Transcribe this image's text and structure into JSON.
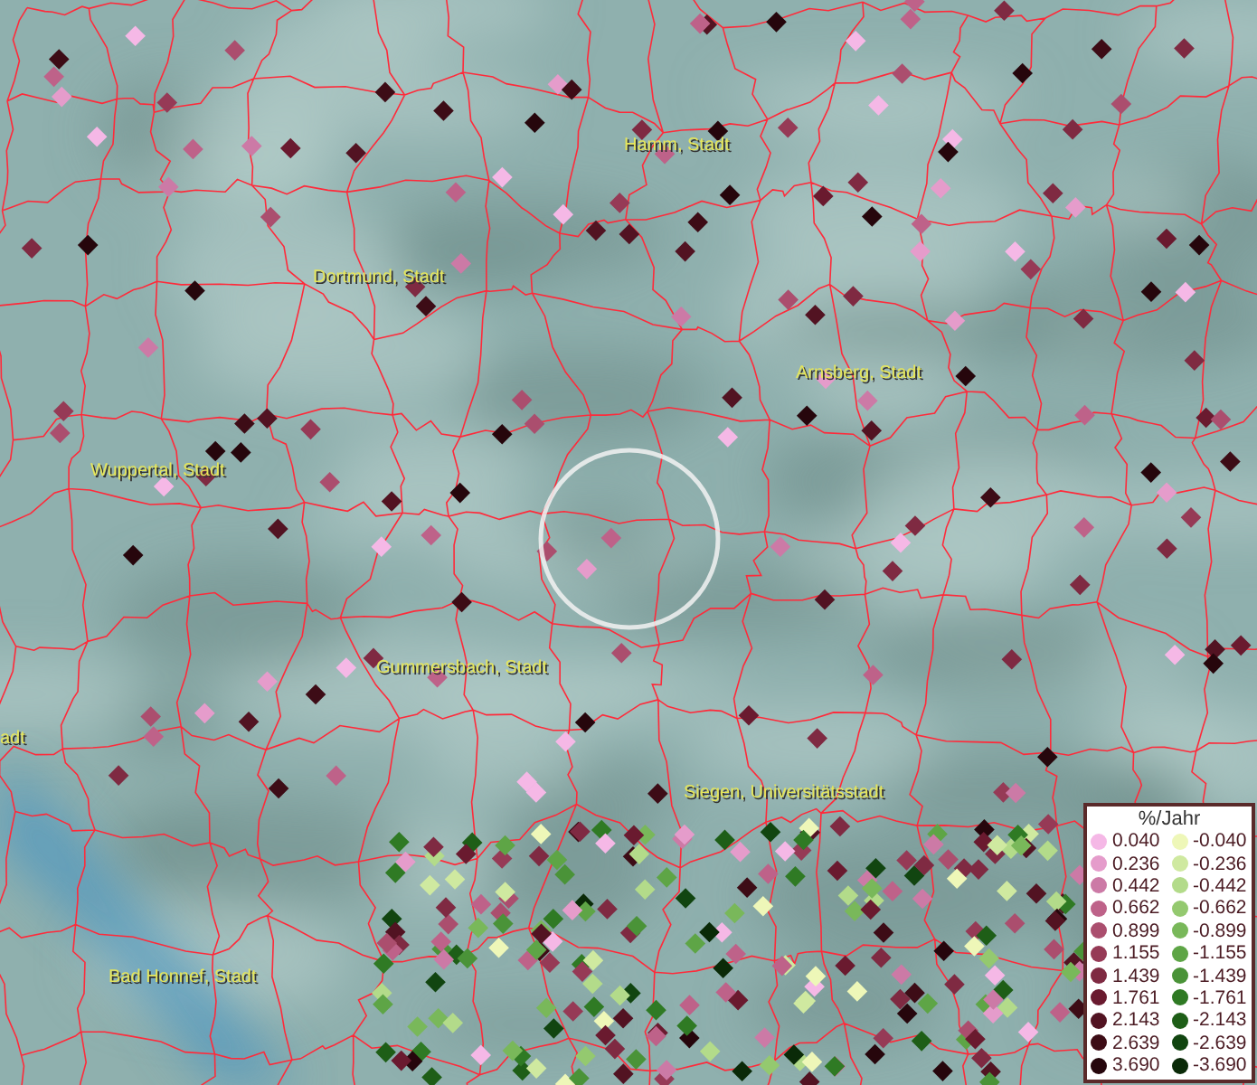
{
  "map": {
    "places": [
      {
        "label": "Hamm, Stadt"
      },
      {
        "label": "Dortmund, Stadt"
      },
      {
        "label": "Arnsberg, Stadt"
      },
      {
        "label": "Wuppertal, Stadt"
      },
      {
        "label": "adt"
      },
      {
        "label": "Gummersbach, Stadt"
      },
      {
        "label": "Siegen, Universitätsstadt"
      },
      {
        "label": "Bad Honnef, Stadt"
      }
    ]
  },
  "legend": {
    "title": "%/Jahr",
    "positive": [
      {
        "label": "0.040",
        "color": "#f5b8e6"
      },
      {
        "label": "0.236",
        "color": "#e59ccb"
      },
      {
        "label": "0.442",
        "color": "#cc7aa6"
      },
      {
        "label": "0.662",
        "color": "#be6289"
      },
      {
        "label": "0.899",
        "color": "#ab4e6e"
      },
      {
        "label": "1.155",
        "color": "#963a56"
      },
      {
        "label": "1.439",
        "color": "#7f2a42"
      },
      {
        "label": "1.761",
        "color": "#6a1a2f"
      },
      {
        "label": "2.143",
        "color": "#521322"
      },
      {
        "label": "2.639",
        "color": "#3d0c16"
      },
      {
        "label": "3.690",
        "color": "#26060c"
      }
    ],
    "negative": [
      {
        "label": "-0.040",
        "color": "#eef7b8"
      },
      {
        "label": "-0.236",
        "color": "#cfe9a0"
      },
      {
        "label": "-0.442",
        "color": "#b3db8a"
      },
      {
        "label": "-0.662",
        "color": "#94c96f"
      },
      {
        "label": "-0.899",
        "color": "#79b85a"
      },
      {
        "label": "-1.155",
        "color": "#5ea546"
      },
      {
        "label": "-1.439",
        "color": "#4a9338"
      },
      {
        "label": "-1.761",
        "color": "#2f7a24"
      },
      {
        "label": "-2.143",
        "color": "#1e5e17"
      },
      {
        "label": "-2.639",
        "color": "#114510"
      },
      {
        "label": "-3.690",
        "color": "#0a2a08"
      }
    ]
  }
}
